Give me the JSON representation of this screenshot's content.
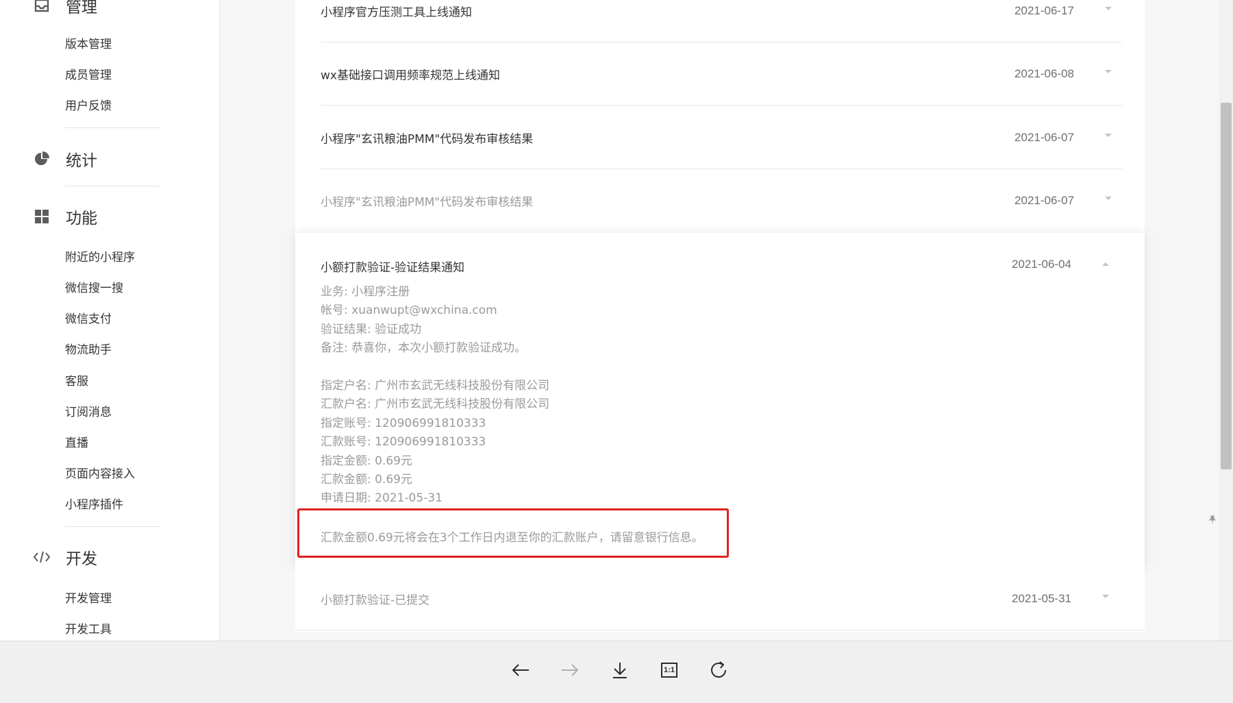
{
  "sidebar": {
    "sections": [
      {
        "title": "管理",
        "icon": "inbox-icon"
      },
      {
        "title": "统计",
        "icon": "pie-chart-icon"
      },
      {
        "title": "功能",
        "icon": "grid-icon"
      },
      {
        "title": "开发",
        "icon": "code-icon"
      }
    ],
    "manage_items": [
      "版本管理",
      "成员管理",
      "用户反馈"
    ],
    "feature_items": [
      "附近的小程序",
      "微信搜一搜",
      "微信支付",
      "物流助手",
      "客服",
      "订阅消息",
      "直播",
      "页面内容接入",
      "小程序插件"
    ],
    "dev_items": [
      "开发管理",
      "开发工具"
    ]
  },
  "messages": [
    {
      "title": "小程序官方压测工具上线通知",
      "date": "2021-06-17",
      "read": false
    },
    {
      "title": "wx基础接口调用频率规范上线通知",
      "date": "2021-06-08",
      "read": false
    },
    {
      "title": "小程序\"玄讯粮油PMM\"代码发布审核结果",
      "date": "2021-06-07",
      "read": false
    },
    {
      "title": "小程序\"玄讯粮油PMM\"代码发布审核结果",
      "date": "2021-06-07",
      "read": true
    }
  ],
  "expanded": {
    "title": "小额打款验证-验证结果通知",
    "date": "2021-06-04",
    "lines_a": [
      "业务: 小程序注册",
      "帐号: xuanwupt@wxchina.com",
      "验证结果: 验证成功",
      "备注: 恭喜你，本次小额打款验证成功。"
    ],
    "lines_b": [
      "指定户名: 广州市玄武无线科技股份有限公司",
      "汇款户名: 广州市玄武无线科技股份有限公司",
      "指定账号: 120906991810333",
      "汇款账号: 120906991810333",
      "指定金额: 0.69元",
      "汇款金额: 0.69元",
      "申请日期: 2021-05-31"
    ],
    "notice": "汇款金额0.69元将会在3个工作日内退至你的汇款账户，请留意银行信息。",
    "highlight_color": "#e02020"
  },
  "last_message": {
    "title": "小额打款验证-已提交",
    "date": "2021-05-31"
  },
  "toolbar": {
    "buttons": [
      "back-arrow-icon",
      "forward-arrow-icon",
      "download-icon",
      "actual-size-icon",
      "rotate-icon"
    ],
    "actual_size_label": "1:1"
  }
}
